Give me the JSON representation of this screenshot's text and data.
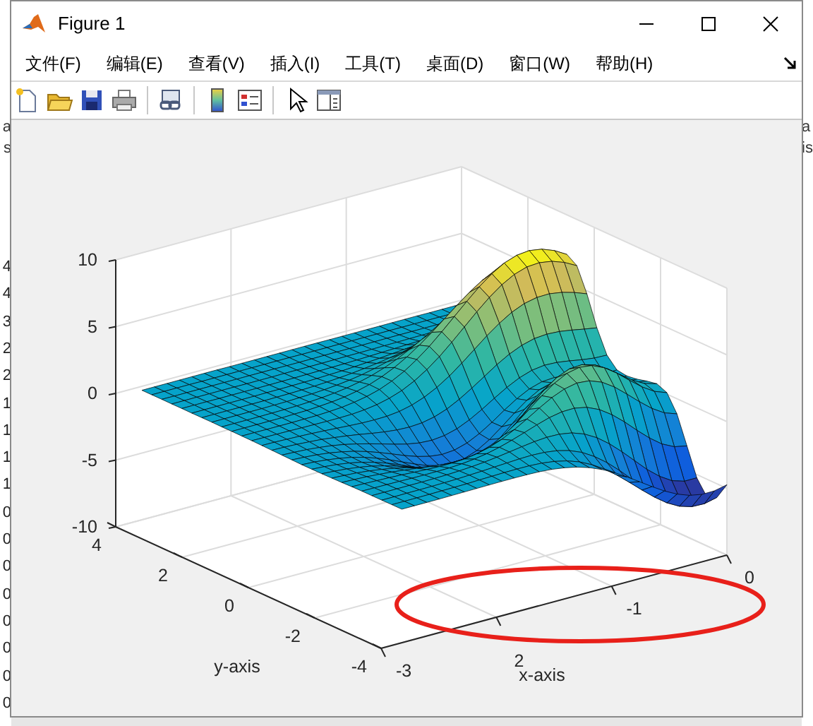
{
  "window": {
    "title": "Figure 1"
  },
  "menu": [
    {
      "label": "文件(F)"
    },
    {
      "label": "编辑(E)"
    },
    {
      "label": "查看(V)"
    },
    {
      "label": "插入(I)"
    },
    {
      "label": "工具(T)"
    },
    {
      "label": "桌面(D)"
    },
    {
      "label": "窗口(W)"
    },
    {
      "label": "帮助(H)"
    }
  ],
  "background_window": {
    "left_texts": [
      "a",
      "s"
    ],
    "left_numbers": [
      "4",
      "4",
      "3",
      "2",
      "2",
      "1",
      "1",
      "1",
      "1",
      "0",
      "0",
      "0",
      "0",
      "0",
      "0",
      "0",
      "0"
    ],
    "right_texts": [
      "a",
      "is"
    ]
  },
  "axes": {
    "z_ticks": [
      "10",
      "5",
      "0",
      "-5",
      "-10"
    ],
    "y_ticks": [
      "4",
      "2",
      "0",
      "-2",
      "-4"
    ],
    "x_ticks": [
      "-3",
      "2",
      "-1",
      "0"
    ],
    "ylabel": "y-axis",
    "xlabel": "x-axis"
  },
  "annotation": {
    "kind": "ellipse"
  }
}
